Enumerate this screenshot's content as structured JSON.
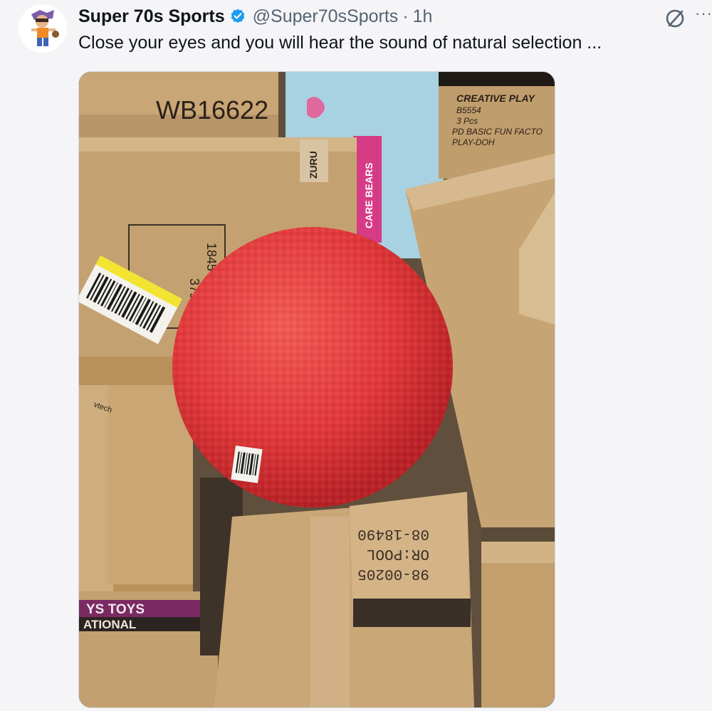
{
  "post": {
    "author_name": "Super 70s Sports",
    "handle": "@Super70sSports",
    "separator": "·",
    "timestamp": "1h",
    "text": "Close your eyes and you will hear the sound of natural selection ...",
    "more_label": "···"
  },
  "icons": {
    "avatar": "cartoon-athlete-avatar",
    "verified": "verified-badge-icon",
    "grok": "grok-icon",
    "more": "more-icon"
  },
  "photo": {
    "box_labels": {
      "top_left": "WB16622",
      "creative_play_1": "CREATIVE PLAY",
      "creative_play_2": "B5554",
      "creative_play_3": "3 Pcs",
      "creative_play_4": "PD BASIC FUN FACTO",
      "creative_play_5": "PLAY-DOH",
      "zuru": "ZURU",
      "care_bears": "CARE BEARS",
      "number_1": "379",
      "number_2": "1845",
      "toys": "YS TOYS",
      "national": "ATIONAL",
      "code_1": "98-00205",
      "code_2": "OR:POOL",
      "code_3": "08-18490",
      "vtech": "vtech"
    }
  },
  "colors": {
    "accent": "#1d9bf0",
    "ball": "#e8393b",
    "cardboard": "#c9a878",
    "background": "#f5f5f7",
    "secondary_text": "#536471"
  }
}
